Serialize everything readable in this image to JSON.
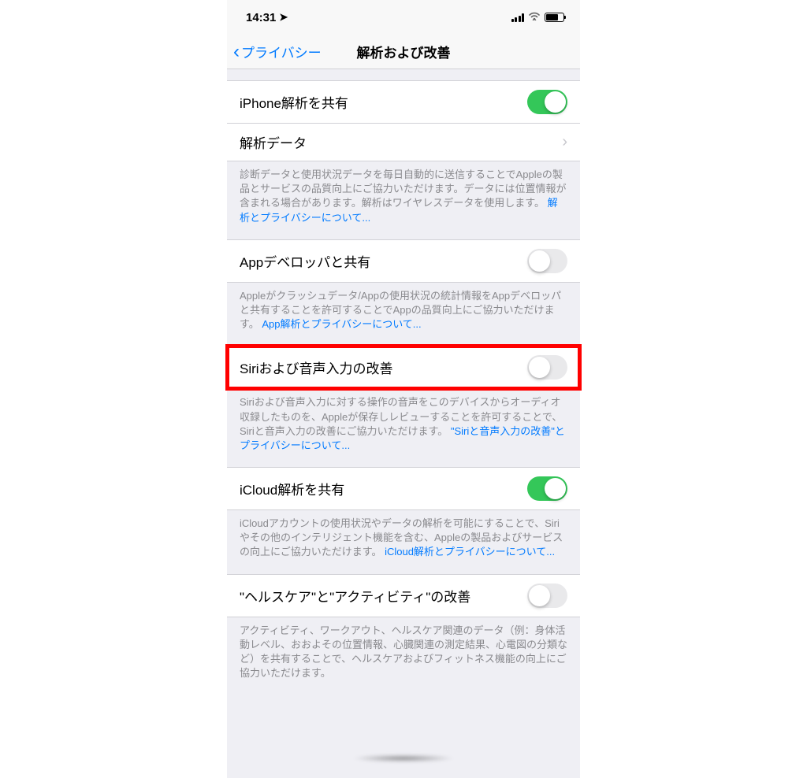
{
  "statusBar": {
    "time": "14:31"
  },
  "nav": {
    "back": "プライバシー",
    "title": "解析および改善"
  },
  "sections": {
    "shareAnalytics": {
      "label": "iPhone解析を共有",
      "on": true
    },
    "analyticsData": {
      "label": "解析データ"
    },
    "footer1": {
      "text": "診断データと使用状況データを毎日自動的に送信することでAppleの製品とサービスの品質向上にご協力いただけます。データには位置情報が含まれる場合があります。解析はワイヤレスデータを使用します。",
      "link": "解析とプライバシーについて..."
    },
    "shareAppDev": {
      "label": "Appデベロッパと共有",
      "on": false
    },
    "footer2": {
      "text": "Appleがクラッシュデータ/Appの使用状況の統計情報をAppデベロッパと共有することを許可することでAppの品質向上にご協力いただけます。",
      "link": "App解析とプライバシーについて..."
    },
    "siri": {
      "label": "Siriおよび音声入力の改善",
      "on": false
    },
    "footer3": {
      "text": "Siriおよび音声入力に対する操作の音声をこのデバイスからオーディオ収録したものを、Appleが保存しレビューすることを許可することで、Siriと音声入力の改善にご協力いただけます。",
      "link": "\"Siriと音声入力の改善\"とプライバシーについて..."
    },
    "icloud": {
      "label": "iCloud解析を共有",
      "on": true
    },
    "footer4": {
      "text": "iCloudアカウントの使用状況やデータの解析を可能にすることで、Siriやその他のインテリジェント機能を含む、Appleの製品およびサービスの向上にご協力いただけます。",
      "link": "iCloud解析とプライバシーについて..."
    },
    "health": {
      "label": "\"ヘルスケア\"と\"アクティビティ\"の改善",
      "on": false
    },
    "footer5": {
      "text": "アクティビティ、ワークアウト、ヘルスケア関連のデータ（例：身体活動レベル、おおよその位置情報、心臓関連の測定結果、心電図の分類など）を共有することで、ヘルスケアおよびフィットネス機能の向上にご協力いただけます。"
    }
  }
}
